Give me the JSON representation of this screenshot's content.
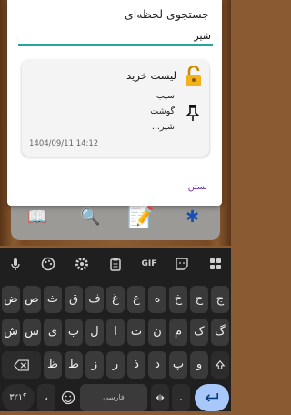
{
  "dialog": {
    "title": "جستجوی لحظه‌ای",
    "search_value": "شیر",
    "close_label": "بستن"
  },
  "card": {
    "title": "لیست خرید",
    "lines": [
      "سیب",
      "گوشت",
      "شیر..."
    ],
    "date": "1404/09/11   14:12"
  },
  "keyboard": {
    "row1": [
      "ج",
      "ح",
      "خ",
      "ه",
      "ع",
      "غ",
      "ف",
      "ق",
      "ث",
      "ص",
      "ض"
    ],
    "row1_nums": [
      "",
      "",
      "",
      "",
      "",
      "",
      "",
      "",
      "",
      "",
      ""
    ],
    "row2": [
      "گ",
      "ک",
      "م",
      "ن",
      "ت",
      "ا",
      "ل",
      "ب",
      "ی",
      "س",
      "ش"
    ],
    "row3": [
      "و",
      "پ",
      "د",
      "ذ",
      "ر",
      "ز",
      "ط",
      "ظ"
    ],
    "symbols_label": "؟۳۲۱",
    "comma": "،",
    "space_label": "فارسی",
    "period": ".",
    "gif_label": "GIF"
  },
  "colors": {
    "accent": "#26a69a",
    "link": "#6a2fb0",
    "enter": "#a8c7fa"
  }
}
